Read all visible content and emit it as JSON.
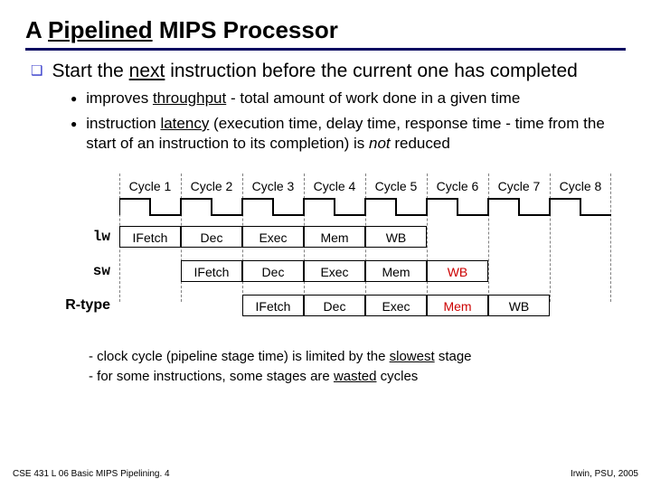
{
  "title": {
    "pre": "A ",
    "u": "Pipelined",
    "post": " MIPS Processor"
  },
  "bullet1": {
    "pre": "Start the ",
    "u": "next",
    "post": " instruction before the current one has completed"
  },
  "sub": [
    {
      "pre": "improves ",
      "u": "throughput",
      "post": " - total amount of work done in a given time"
    },
    {
      "pre": "instruction ",
      "u": "latency",
      "mid": " (execution time, delay time, response time - time from the start of an instruction to its completion) is ",
      "ital": "not",
      "post": " reduced"
    }
  ],
  "cycles": [
    "Cycle 1",
    "Cycle 2",
    "Cycle 3",
    "Cycle 4",
    "Cycle 5",
    "Cycle 6",
    "Cycle 7",
    "Cycle 8"
  ],
  "rows": {
    "lw": {
      "label": "lw",
      "mono": true,
      "offset_cycles": 0
    },
    "sw": {
      "label": "sw",
      "mono": true,
      "offset_cycles": 1
    },
    "rtype": {
      "label": "R-type",
      "mono": false,
      "offset_cycles": 2
    }
  },
  "stages": [
    "IFetch",
    "Dec",
    "Exec",
    "Mem",
    "WB"
  ],
  "stages_red_for_rtype": "Mem",
  "stages_red_for_sw": "WB",
  "notes": {
    "n1_pre": "- clock cycle (pipeline stage time) is limited by the ",
    "n1_u": "slowest",
    "n1_post": " stage",
    "n2_pre": "- for some instructions, some stages are ",
    "n2_u": "wasted",
    "n2_post": " cycles"
  },
  "footer": {
    "left": "CSE 431 L 06 Basic MIPS Pipelining. 4",
    "right": "Irwin, PSU, 2005"
  },
  "chart_data": {
    "type": "table",
    "title": "Pipeline diagram: stage occupied per cycle",
    "categories": [
      "Cycle 1",
      "Cycle 2",
      "Cycle 3",
      "Cycle 4",
      "Cycle 5",
      "Cycle 6",
      "Cycle 7",
      "Cycle 8"
    ],
    "series": [
      {
        "name": "lw",
        "values": [
          "IFetch",
          "Dec",
          "Exec",
          "Mem",
          "WB",
          null,
          null,
          null
        ]
      },
      {
        "name": "sw",
        "values": [
          null,
          "IFetch",
          "Dec",
          "Exec",
          "Mem",
          "WB",
          null,
          null
        ]
      },
      {
        "name": "R-type",
        "values": [
          null,
          null,
          "IFetch",
          "Dec",
          "Exec",
          "Mem",
          "WB",
          null
        ]
      }
    ],
    "annotations": [
      {
        "instr": "sw",
        "stage": "WB",
        "note": "wasted",
        "color": "#cc0000"
      },
      {
        "instr": "R-type",
        "stage": "Mem",
        "note": "wasted",
        "color": "#cc0000"
      }
    ]
  }
}
